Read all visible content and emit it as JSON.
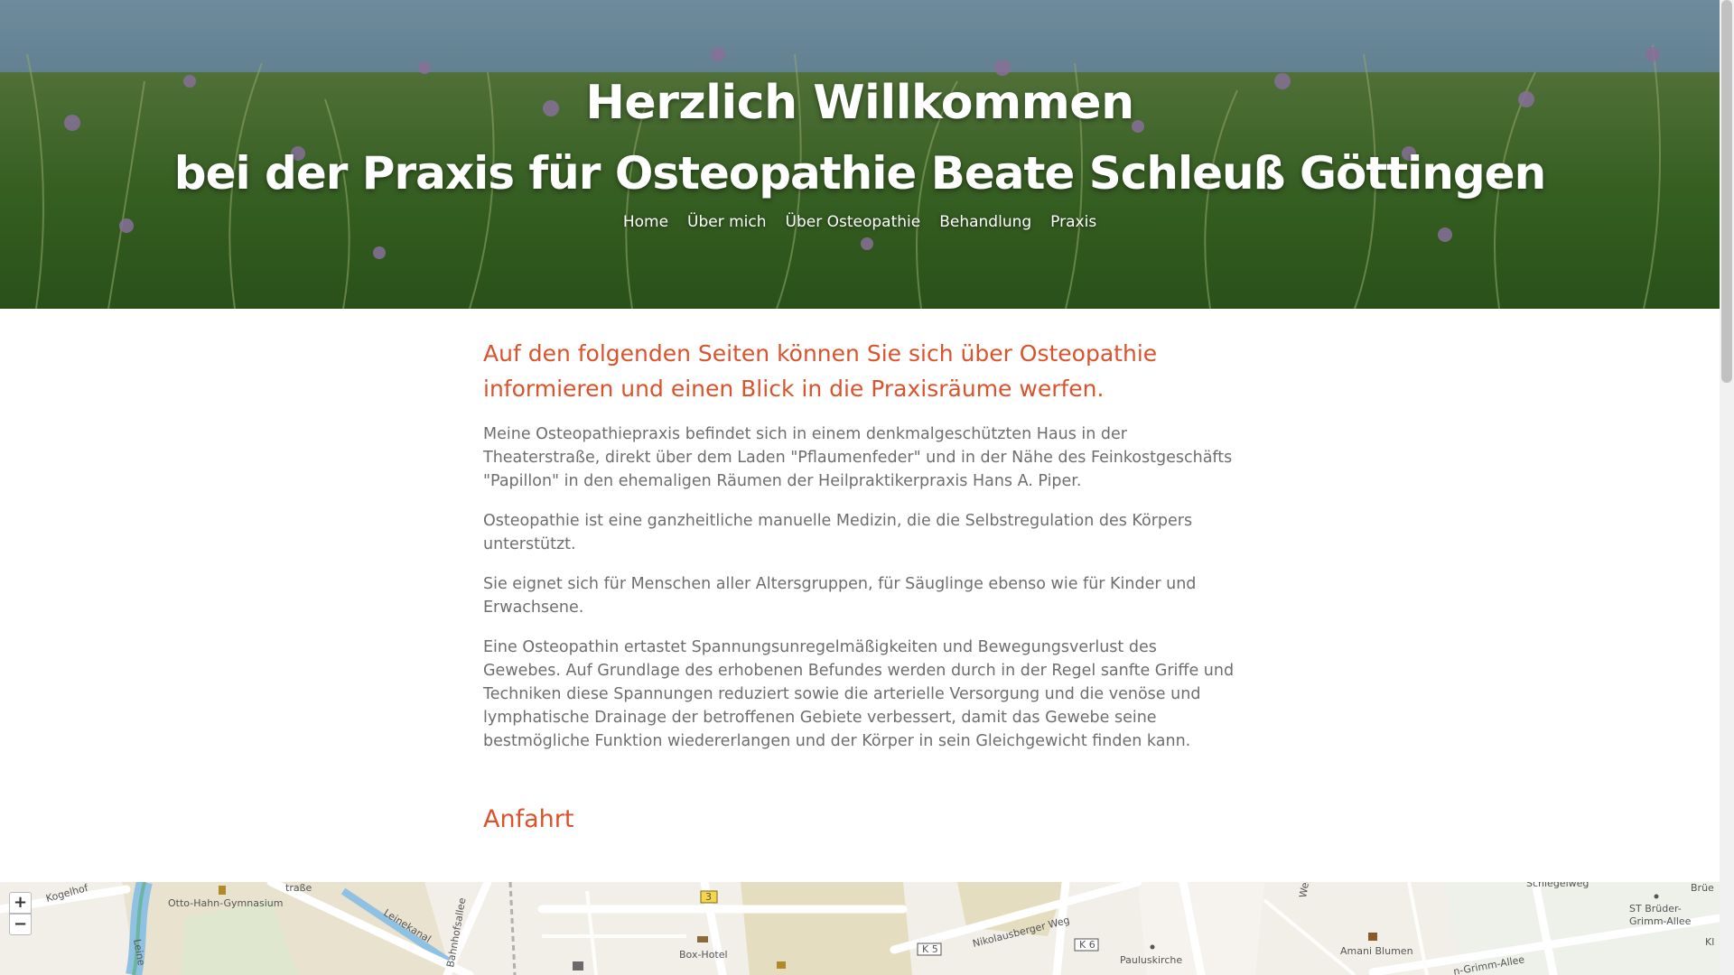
{
  "hero": {
    "title_line1": "Herzlich Willkommen",
    "title_line2": "bei der Praxis für Osteopathie Beate Schleuß Göttingen"
  },
  "nav": {
    "items": [
      "Home",
      "Über mich",
      "Über Osteopathie",
      "Behandlung",
      "Praxis"
    ]
  },
  "main": {
    "lead": "Auf den folgenden Seiten können Sie sich über Osteopathie informieren und einen Blick in die Praxisräume werfen.",
    "paragraphs": [
      "Meine Osteopathiepraxis befindet sich in einem denkmalgeschützten Haus in der Theaterstraße, direkt über dem Laden \"Pflaumenfeder\" und in der Nähe des Feinkostgeschäfts \"Papillon\" in den ehemaligen Räumen der Heilpraktikerpraxis Hans A. Piper.",
      "Osteopathie ist eine ganzheitliche manuelle Medizin, die die Selbstregulation des Körpers unterstützt.",
      "Sie eignet sich für Menschen aller Altersgruppen, für Säuglinge ebenso wie für Kinder und Erwachsene.",
      "Eine Osteopathin ertastet Spannungsunregelmäßigkeiten und Bewegungsverlust des Gewebes. Auf Grundlage des erhobenen Befundes werden durch in der Regel sanfte Griffe und Techniken diese Spannungen reduziert sowie die arterielle Versorgung und die venöse und lymphatische Drainage der betroffenen Gebiete verbessert, damit das Gewebe seine bestmögliche Funktion wiedererlangen und der Körper in sein Gleichgewicht finden kann."
    ]
  },
  "anfahrt": {
    "title": "Anfahrt"
  },
  "map": {
    "zoom_in": "+",
    "zoom_out": "−",
    "labels": {
      "kogelhof": "Kogelhof",
      "gymnasium": "Otto-Hahn-Gymnasium",
      "strasse_frag": "traße",
      "leinekanal": "Leinekanal",
      "bahnhofsallee": "Bahnhofsallee",
      "leine": "Leine",
      "road3": "3",
      "box_hotel": "Box-Hotel",
      "k5": "K 5",
      "nikolausberger": "Nikolausberger Weg",
      "k6": "K 6",
      "pauluskirche": "Pauluskirche",
      "amani": "Amani Blumen",
      "schlegelweg": "Schlegelweg",
      "st_brueder": "ST Brüder-",
      "grimm_allee": "Grimm-Allee",
      "brue_frag": "Brüe",
      "grimm_allee2": "n-Grimm-Allee",
      "weg_frag": "Weg",
      "kl_frag": "Kl"
    }
  },
  "colors": {
    "accent": "#d9532c",
    "body_text": "#6e6e6e",
    "map_background": "#f2efe9"
  }
}
